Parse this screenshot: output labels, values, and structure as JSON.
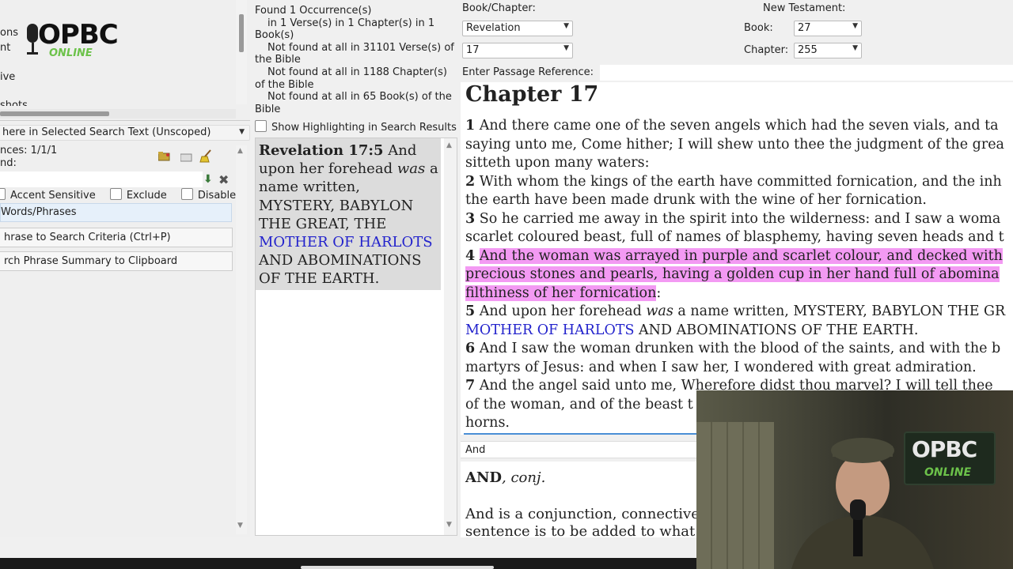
{
  "left": {
    "cut_labels": [
      "ons",
      "nt",
      "ive",
      "shots"
    ],
    "logo_main": "OPBC",
    "logo_sub": "ONLINE",
    "scope_select": "here in Selected Search Text (Unscoped)",
    "occurrences": "nces: 1/1/1",
    "found": "nd:",
    "options": [
      "Accent Sensitive",
      "Exclude",
      "Disable"
    ],
    "words_phrases": "Words/Phrases",
    "btn_add_phrase": "hrase to Search Criteria (Ctrl+P)",
    "btn_copy_summary": "rch Phrase Summary to Clipboard"
  },
  "middle": {
    "results_lines": [
      "Found 1 Occurrence(s)",
      "in 1 Verse(s) in 1 Chapter(s) in 1",
      "Book(s)",
      "Not found at all in 31101 Verse(s) of",
      "the Bible",
      "Not found at all in 1188 Chapter(s)",
      "of the Bible",
      "Not found at all in 65 Book(s) of the",
      "Bible"
    ],
    "show_highlight_label": "Show Highlighting in Search Results",
    "result_ref": "Revelation 17:5",
    "result_text_1": " And",
    "result_text_2": "upon her forehead ",
    "result_italic": "was",
    "result_text_3": " a",
    "result_text_4": "name written,",
    "result_text_5": "MYSTERY, BABYLON",
    "result_text_6": "THE GREAT, THE",
    "result_text_7": "MOTHER OF HARLOTS",
    "result_text_8": "AND ABOMINATIONS",
    "result_text_9": "OF THE EARTH."
  },
  "right": {
    "book_chapter_label": "Book/Chapter:",
    "book_value": "Revelation",
    "chapter_value": "17",
    "nt_label": "New Testament:",
    "book_label": "Book:",
    "book_num": "27",
    "chapter_label": "Chapter:",
    "chapter_num": "255",
    "passage_label": "Enter Passage Reference:",
    "chapter_heading": "Chapter 17",
    "v1n": "1",
    "v1a": "And there came one of the seven angels which had the seven vials, and ta",
    "v1b": "saying unto me, Come hither; I will shew unto thee the judgment of the grea",
    "v1c": "sitteth upon many waters:",
    "v2n": "2",
    "v2a": "With whom the kings of the earth have committed fornication, and the inh",
    "v2b": "the earth have been made drunk with the wine of her fornication.",
    "v3n": "3",
    "v3a": "So he carried me away in the spirit into the wilderness: and I saw a woma",
    "v3b": "scarlet coloured beast, full of names of blasphemy, having seven heads and t",
    "v4n": "4",
    "v4a": "And the woman was arrayed in purple and scarlet colour, and decked with",
    "v4b": "precious stones and pearls, having a golden cup in her hand full of abomina",
    "v4c": "filthiness of her fornication",
    "v4c_end": ":",
    "v5n": "5",
    "v5a": "And upon her forehead ",
    "v5_italic": "was",
    "v5b": " a name written, MYSTERY, BABYLON THE GR",
    "v5c_blue": "MOTHER OF HARLOTS",
    "v5c": " AND ABOMINATIONS OF THE EARTH.",
    "v6n": "6",
    "v6a": "And I saw the woman drunken with the blood of the saints, and with the b",
    "v6b": "martyrs of Jesus: and when I saw her, I wondered with great admiration.",
    "v7n": "7",
    "v7a": "And the angel said unto me, Wherefore didst thou marvel? I will tell thee",
    "v7b": "of the woman, and of the beast t",
    "v7c": "horns.",
    "dict_word": "And",
    "dict_head": "AND",
    "dict_pos": ", conj.",
    "dict_body_1": "And is a conjunction, connective",
    "dict_body_2": "sentence is to be added to what"
  },
  "webcam": {
    "logo_main": "OPBC",
    "logo_sub": "ONLINE"
  },
  "colors": {
    "highlight": "#f39af3",
    "link_blue": "#2222cc",
    "logo_green": "#6cc24a"
  }
}
